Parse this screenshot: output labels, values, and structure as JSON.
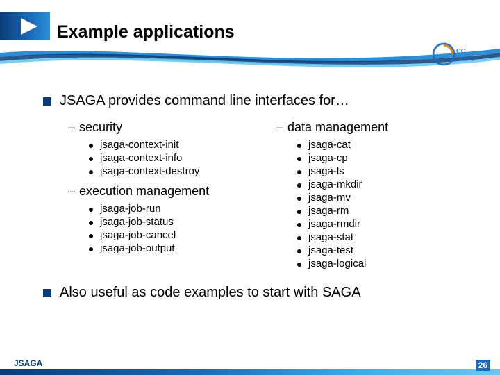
{
  "title": "Example applications",
  "logo_text": "CCIN2P3",
  "main": [
    {
      "text": "JSAGA provides command line interfaces for…"
    },
    {
      "text": "Also useful as code examples to start with SAGA"
    }
  ],
  "left_groups": [
    {
      "label": "security",
      "items": [
        "jsaga-context-init",
        "jsaga-context-info",
        "jsaga-context-destroy"
      ]
    },
    {
      "label": "execution management",
      "items": [
        "jsaga-job-run",
        "jsaga-job-status",
        "jsaga-job-cancel",
        "jsaga-job-output"
      ]
    }
  ],
  "right_groups": [
    {
      "label": "data management",
      "items": [
        "jsaga-cat",
        "jsaga-cp",
        "jsaga-ls",
        "jsaga-mkdir",
        "jsaga-mv",
        "jsaga-rm",
        "jsaga-rmdir",
        "jsaga-stat",
        "jsaga-test",
        "jsaga-logical"
      ]
    }
  ],
  "footer": {
    "left": "JSAGA",
    "page": "26"
  }
}
